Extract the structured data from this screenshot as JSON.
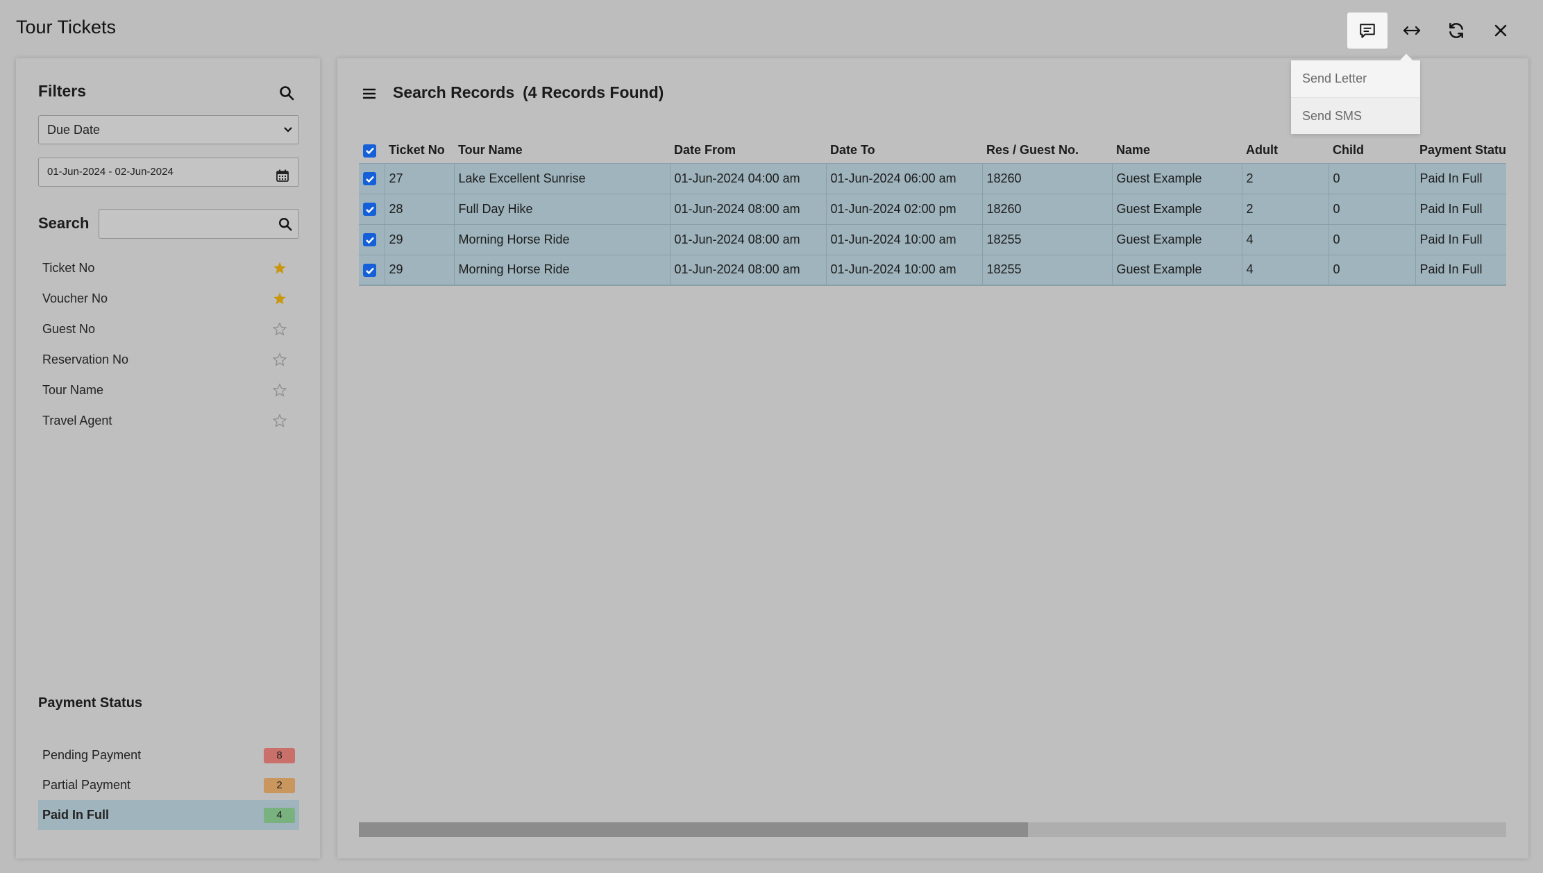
{
  "app": {
    "title": "Tour Tickets"
  },
  "topbar": {
    "icons": [
      "message-icon",
      "resize-icon",
      "refresh-icon",
      "close-icon"
    ]
  },
  "dropdown": {
    "items": [
      "Send Letter",
      "Send SMS"
    ]
  },
  "filters": {
    "title": "Filters",
    "date_type": "Due Date",
    "date_range": "01-Jun-2024 - 02-Jun-2024",
    "search_label": "Search",
    "search_value": "",
    "fields": [
      {
        "label": "Ticket No",
        "starred": true
      },
      {
        "label": "Voucher No",
        "starred": true
      },
      {
        "label": "Guest No",
        "starred": false
      },
      {
        "label": "Reservation No",
        "starred": false
      },
      {
        "label": "Tour Name",
        "starred": false
      },
      {
        "label": "Travel Agent",
        "starred": false
      }
    ],
    "payment_status": {
      "title": "Payment Status",
      "items": [
        {
          "label": "Pending Payment",
          "count": "8",
          "color": "#c9706a"
        },
        {
          "label": "Partial Payment",
          "count": "2",
          "color": "#c9965e"
        },
        {
          "label": "Paid In Full",
          "count": "4",
          "color": "#79b17f"
        }
      ]
    }
  },
  "records": {
    "title": "Search Records",
    "count_text": "(4 Records Found)",
    "columns": [
      "Ticket No",
      "Tour Name",
      "Date From",
      "Date To",
      "Res / Guest No.",
      "Name",
      "Adult",
      "Child",
      "Payment Status"
    ],
    "rows": [
      [
        "27",
        "Lake Excellent Sunrise",
        "01-Jun-2024 04:00 am",
        "01-Jun-2024 06:00 am",
        "18260",
        "Guest Example",
        "2",
        "0",
        "Paid In Full"
      ],
      [
        "28",
        "Full Day Hike",
        "01-Jun-2024 08:00 am",
        "01-Jun-2024 02:00 pm",
        "18260",
        "Guest Example",
        "2",
        "0",
        "Paid In Full"
      ],
      [
        "29",
        "Morning Horse Ride",
        "01-Jun-2024 08:00 am",
        "01-Jun-2024 10:00 am",
        "18255",
        "Guest Example",
        "4",
        "0",
        "Paid In Full"
      ],
      [
        "29",
        "Morning Horse Ride",
        "01-Jun-2024 08:00 am",
        "01-Jun-2024 10:00 am",
        "18255",
        "Guest Example",
        "4",
        "0",
        "Paid In Full"
      ]
    ]
  },
  "colors": {
    "background": "#bdbdbd",
    "row_selected": "#9fb4bd",
    "checkbox": "#1560d8",
    "star_active": "#c9960e"
  }
}
